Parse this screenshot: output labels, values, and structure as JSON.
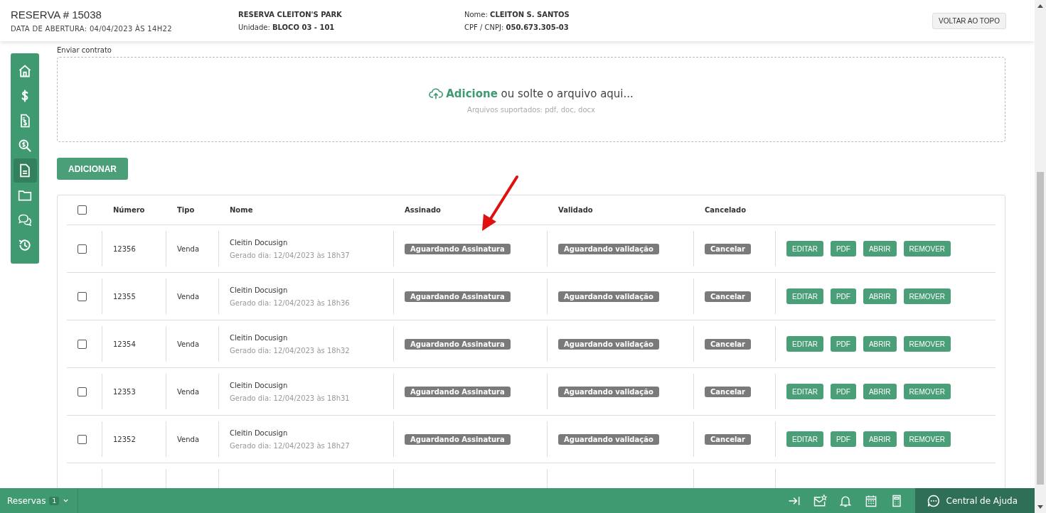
{
  "header": {
    "reservation": "RESERVA # 15038",
    "opened": "DATA DE ABERTURA: 04/04/2023 ÀS 14H22",
    "project": "RESERVA CLEITON'S PARK",
    "unit": "Unidade: **BLOCO 03 - 101**",
    "name": "Nome: **CLEITON S. SANTOS**",
    "doc": "CPF / CNPJ: **050.673.305-03**",
    "top_button": "VOLTAR AO TOPO"
  },
  "sidebar": {
    "items": [
      {
        "selected": false
      },
      {
        "selected": false
      },
      {
        "selected": false
      },
      {
        "selected": false
      },
      {
        "selected": true
      },
      {
        "selected": false
      },
      {
        "selected": false
      },
      {
        "selected": false
      }
    ]
  },
  "upload": {
    "label": "Enviar contrato",
    "link": "Adicione",
    "text": " ou solte o arquivo aqui...",
    "hint": "Arquivos suportados: pdf, doc, docx"
  },
  "add_button": "ADICIONAR",
  "table": {
    "select_all_checked": false,
    "columns": [
      "Número",
      "Tipo",
      "Nome",
      "Assinado",
      "Validado",
      "Cancelado"
    ],
    "rows": [
      {
        "checked": false,
        "number": "12356",
        "type": "Venda",
        "name": "Cleitin Docusign",
        "generated": "Gerado dia: 12/04/2023 às 18h37",
        "signed": "Aguardando Assinatura",
        "validated": "Aguardando validação",
        "cancel": "Cancelar",
        "actions": [
          "EDITAR",
          "PDF",
          "ABRIR",
          "REMOVER"
        ]
      },
      {
        "checked": false,
        "number": "12355",
        "type": "Venda",
        "name": "Cleitin Docusign",
        "generated": "Gerado dia: 12/04/2023 às 18h36",
        "signed": "Aguardando Assinatura",
        "validated": "Aguardando validação",
        "cancel": "Cancelar",
        "actions": [
          "EDITAR",
          "PDF",
          "ABRIR",
          "REMOVER"
        ]
      },
      {
        "checked": false,
        "number": "12354",
        "type": "Venda",
        "name": "Cleitin Docusign",
        "generated": "Gerado dia: 12/04/2023 às 18h32",
        "signed": "Aguardando Assinatura",
        "validated": "Aguardando validação",
        "cancel": "Cancelar",
        "actions": [
          "EDITAR",
          "PDF",
          "ABRIR",
          "REMOVER"
        ]
      },
      {
        "checked": false,
        "number": "12353",
        "type": "Venda",
        "name": "Cleitin Docusign",
        "generated": "Gerado dia: 12/04/2023 às 18h31",
        "signed": "Aguardando Assinatura",
        "validated": "Aguardando validação",
        "cancel": "Cancelar",
        "actions": [
          "EDITAR",
          "PDF",
          "ABRIR",
          "REMOVER"
        ]
      },
      {
        "checked": false,
        "number": "12352",
        "type": "Venda",
        "name": "Cleitin Docusign",
        "generated": "Gerado dia: 12/04/2023 às 18h27",
        "signed": "Aguardando Assinatura",
        "validated": "Aguardando validação",
        "cancel": "Cancelar",
        "actions": [
          "EDITAR",
          "PDF",
          "ABRIR",
          "REMOVER"
        ]
      }
    ]
  },
  "footer": {
    "reservations": "Reservas",
    "count": "1",
    "help": "Central de Ajuda"
  }
}
